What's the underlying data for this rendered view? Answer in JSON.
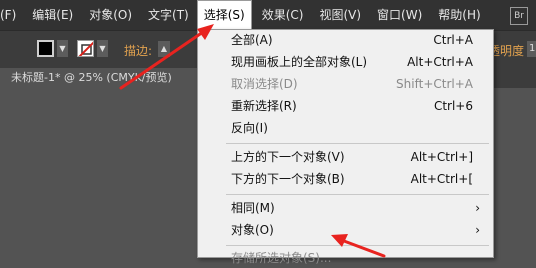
{
  "menubar": {
    "items": [
      "(F)",
      "编辑(E)",
      "对象(O)",
      "文字(T)",
      "选择(S)",
      "效果(C)",
      "视图(V)",
      "窗口(W)",
      "帮助(H)"
    ],
    "active_index": 4,
    "badge": "Br"
  },
  "controlbar": {
    "stroke_label": "描边:",
    "opacity_label": "不透明度:",
    "opacity_value": "1"
  },
  "document_tab": {
    "title": "未标题-1* @ 25% (CMYK/预览)"
  },
  "select_menu": {
    "items": [
      {
        "label": "全部(A)",
        "shortcut": "Ctrl+A",
        "disabled": false
      },
      {
        "label": "现用画板上的全部对象(L)",
        "shortcut": "Alt+Ctrl+A",
        "disabled": false
      },
      {
        "label": "取消选择(D)",
        "shortcut": "Shift+Ctrl+A",
        "disabled": true
      },
      {
        "label": "重新选择(R)",
        "shortcut": "Ctrl+6",
        "disabled": false
      },
      {
        "label": "反向(I)",
        "shortcut": "",
        "disabled": false
      },
      {
        "label": "上方的下一个对象(V)",
        "shortcut": "Alt+Ctrl+]",
        "disabled": false
      },
      {
        "label": "下方的下一个对象(B)",
        "shortcut": "Alt+Ctrl+[",
        "disabled": false
      },
      {
        "label": "相同(M)",
        "shortcut": "",
        "submenu": true,
        "disabled": false
      },
      {
        "label": "对象(O)",
        "shortcut": "",
        "submenu": true,
        "disabled": false
      },
      {
        "label": "存储所选对象(S)...",
        "shortcut": "",
        "disabled": true
      }
    ]
  },
  "annotation": {
    "arrow_color": "#e8231f"
  }
}
